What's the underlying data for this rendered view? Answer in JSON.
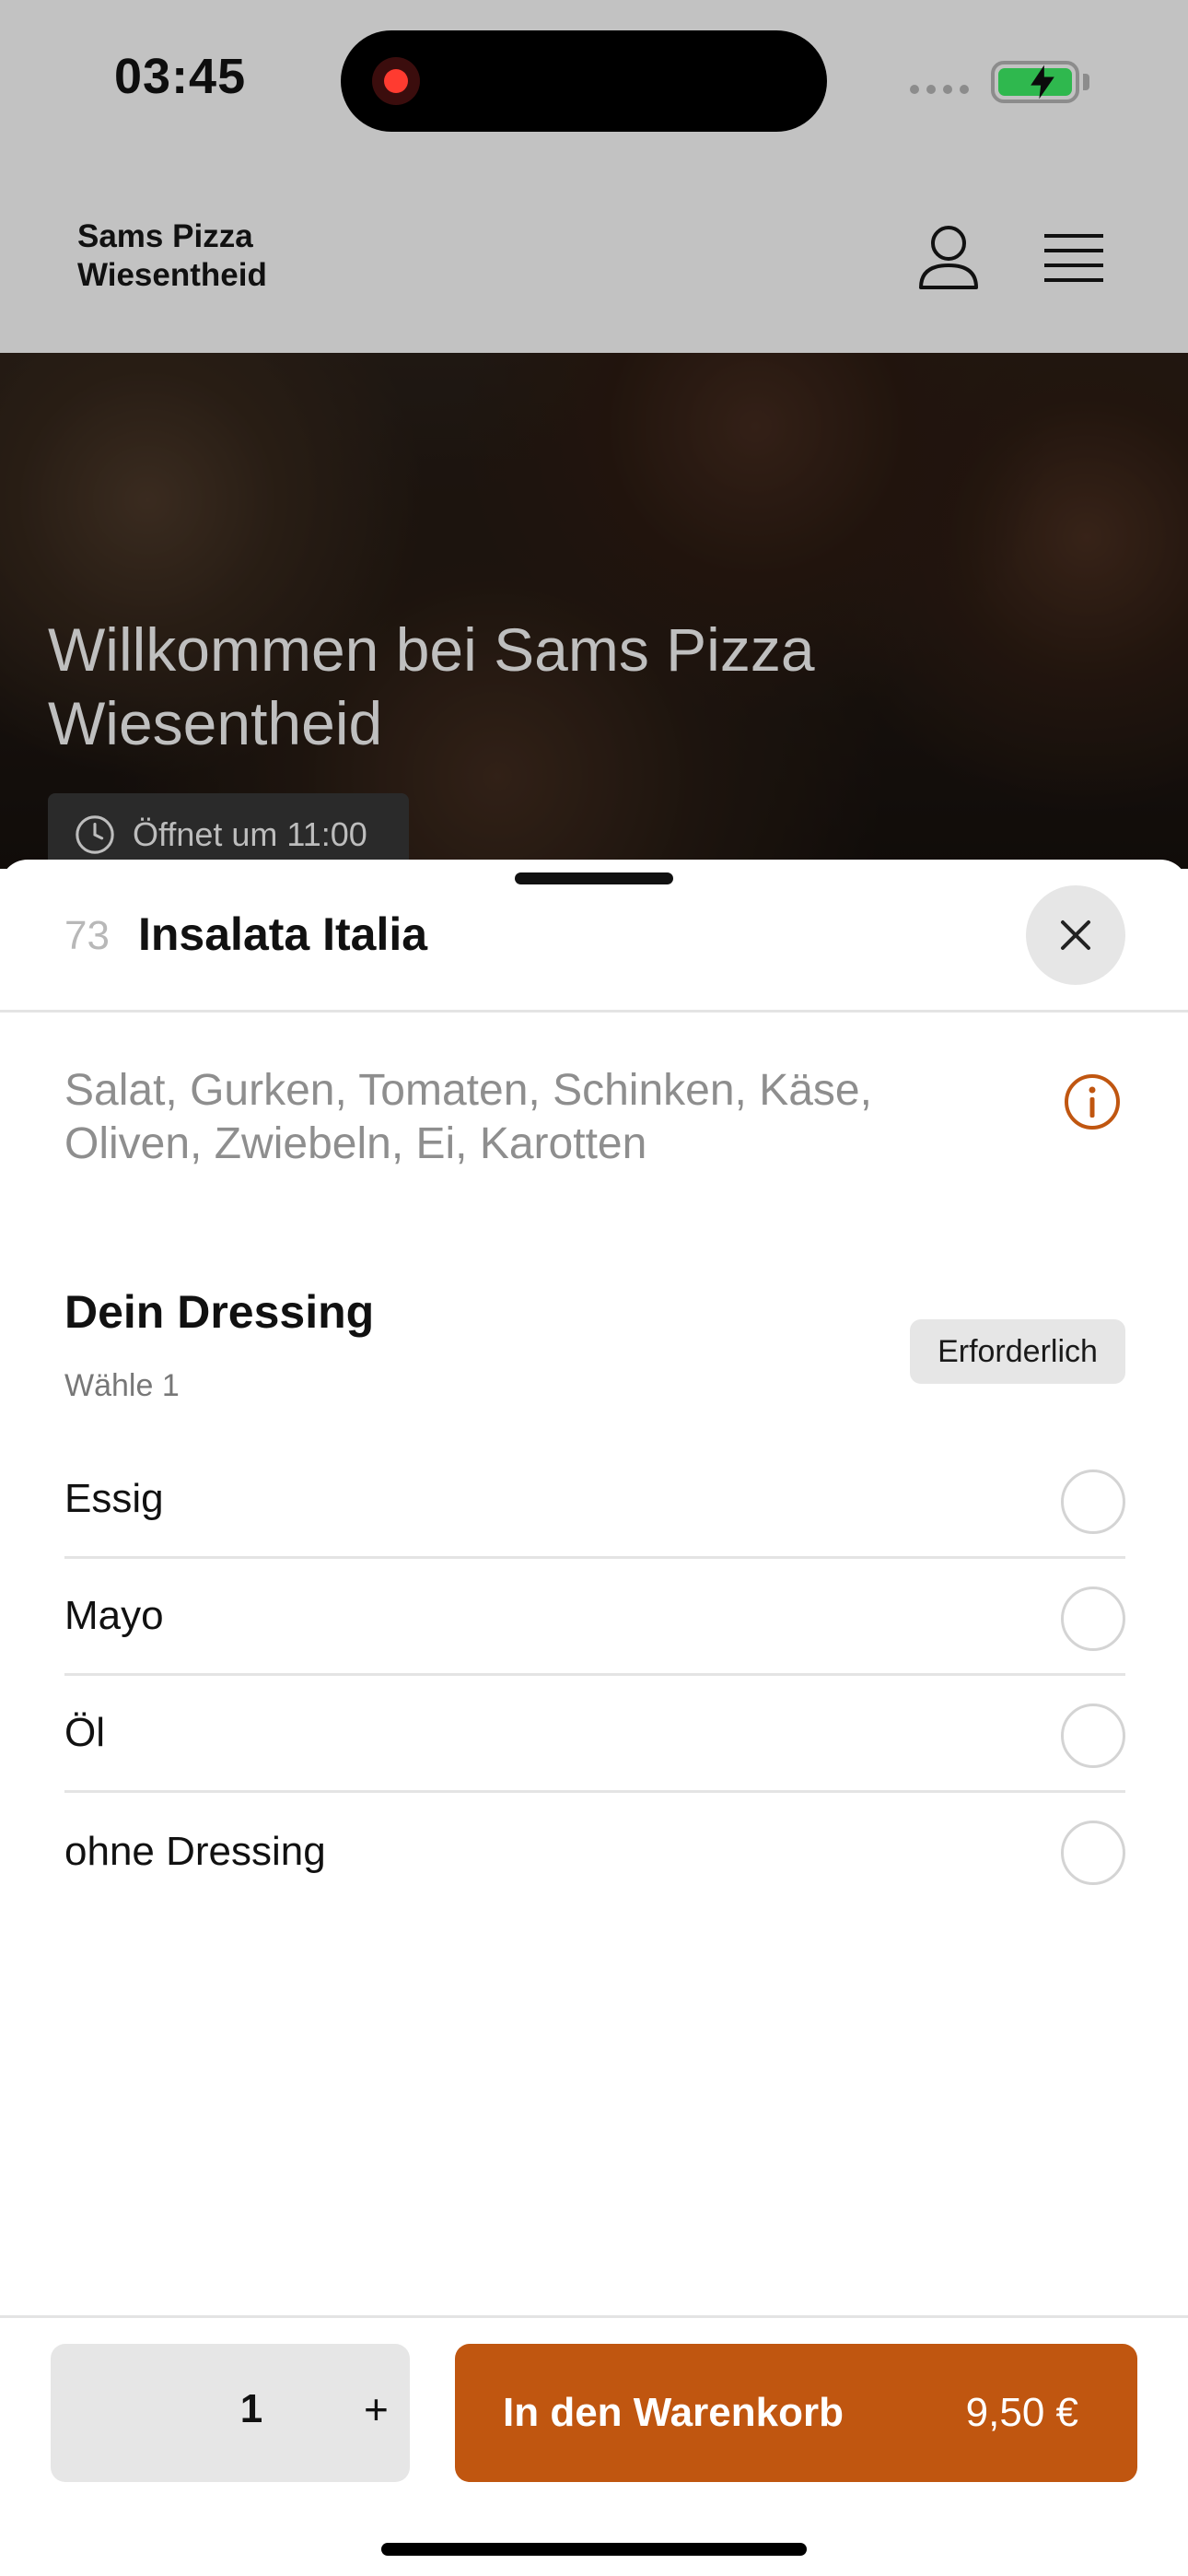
{
  "status_bar": {
    "time": "03:45"
  },
  "header": {
    "brand_line1": "Sams Pizza",
    "brand_line2": "Wiesentheid",
    "icons": [
      "user-icon",
      "menu-icon"
    ]
  },
  "hero": {
    "title": "Willkommen bei Sams Pizza Wiesentheid",
    "badge": "Öffnet um 11:00"
  },
  "sheet": {
    "item_number": "73",
    "item_title": "Insalata Italia",
    "description": "Salat, Gurken, Tomaten, Schinken, Käse, Oliven, Zwiebeln, Ei, Karotten",
    "group": {
      "title": "Dein Dressing",
      "subtitle": "Wähle 1",
      "required_label": "Erforderlich",
      "options": [
        {
          "label": "Essig",
          "selected": false
        },
        {
          "label": "Mayo",
          "selected": false
        },
        {
          "label": "Öl",
          "selected": false
        },
        {
          "label": "ohne Dressing",
          "selected": false
        }
      ]
    }
  },
  "footer": {
    "quantity": "1",
    "plus_label": "+",
    "cart_label": "In den Warenkorb",
    "price": "9,50 €"
  },
  "colors": {
    "accent": "#c05610",
    "overlay": "#c2c2c2"
  }
}
